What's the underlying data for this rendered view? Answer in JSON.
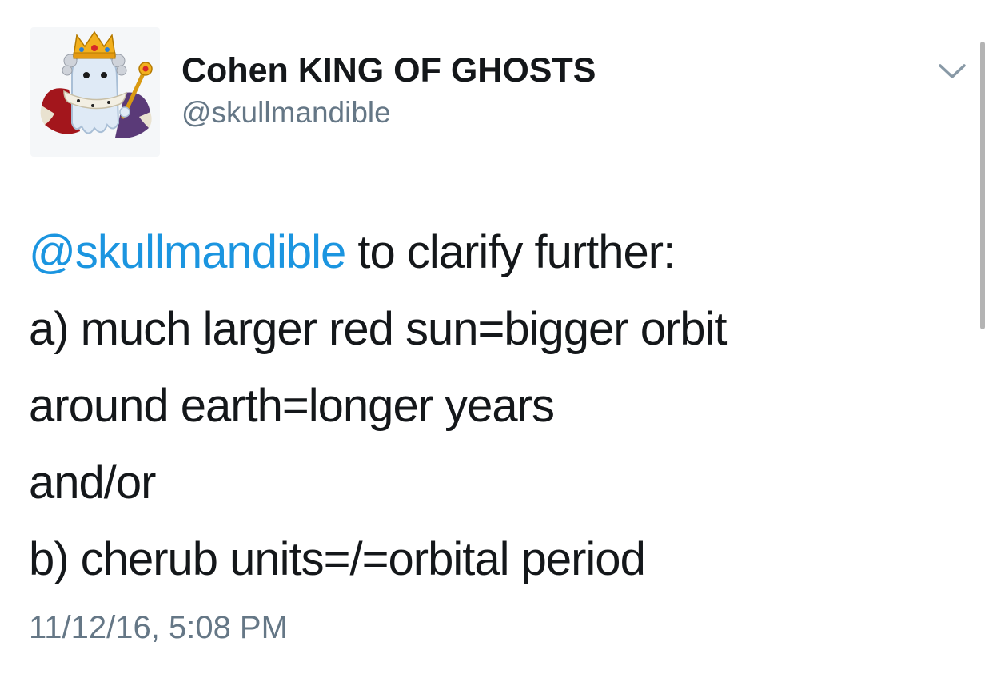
{
  "author": {
    "display_name": "Cohen KING OF GHOSTS",
    "handle": "@skullmandible",
    "avatar_icon": "crowned-ghost-avatar"
  },
  "menu": {
    "icon": "chevron-down-icon"
  },
  "tweet": {
    "mention": "@skullmandible",
    "line1_rest": " to clarify further:",
    "lines": [
      "a) much larger red sun=bigger orbit",
      "around earth=longer years",
      "and/or",
      "b) cherub units=/=orbital period"
    ],
    "timestamp": "11/12/16, 5:08 PM"
  },
  "colors": {
    "mention": "#1b95e0",
    "secondary_text": "#657786",
    "primary_text": "#14171a"
  }
}
